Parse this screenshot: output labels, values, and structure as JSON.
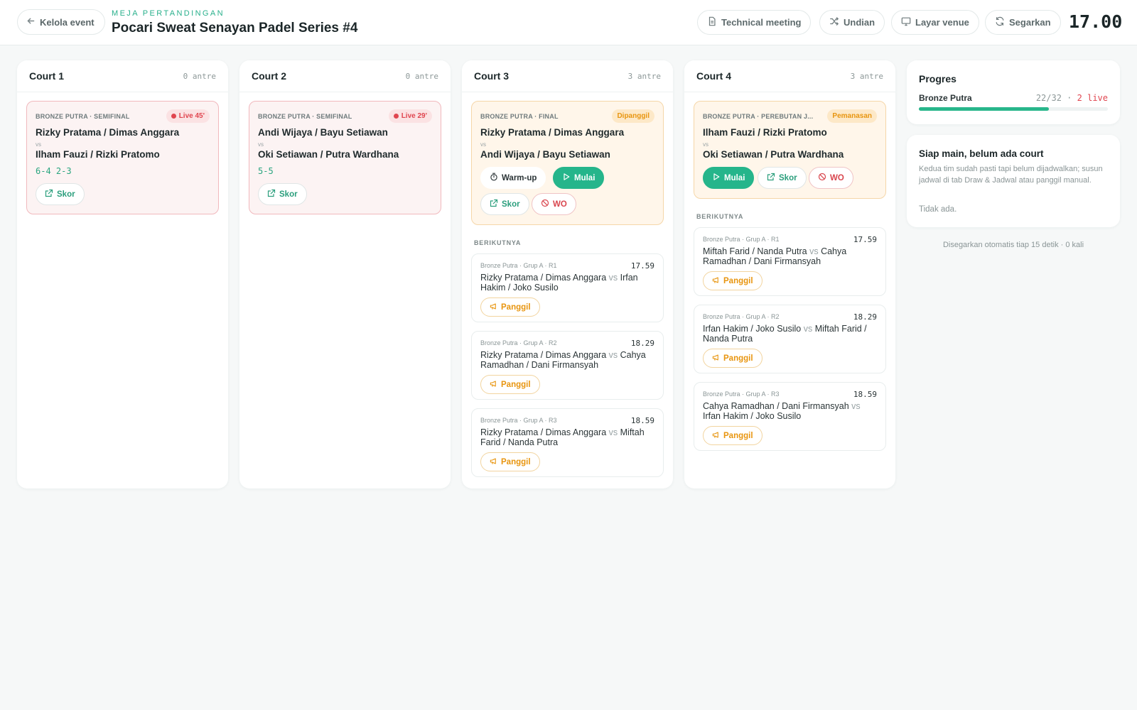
{
  "header": {
    "back_label": "Kelola event",
    "eyebrow": "MEJA PERTANDINGAN",
    "title": "Pocari Sweat Senayan Padel Series #4",
    "buttons": {
      "technical": "Technical meeting",
      "draw": "Undian",
      "venue": "Layar venue",
      "refresh": "Segarkan"
    },
    "clock": "17.00"
  },
  "courts": [
    {
      "name": "Court 1",
      "queue": "0 antre",
      "match": {
        "category": "BRONZE PUTRA · SEMIFINAL",
        "status": "Live 45'",
        "team1": "Rizky Pratama / Dimas Anggara",
        "vs": "vs",
        "team2": "Ilham Fauzi / Rizki Pratomo",
        "score": "6-4 2-3",
        "score_button": "Skor"
      }
    },
    {
      "name": "Court 2",
      "queue": "0 antre",
      "match": {
        "category": "BRONZE PUTRA · SEMIFINAL",
        "status": "Live 29'",
        "team1": "Andi Wijaya / Bayu Setiawan",
        "vs": "vs",
        "team2": "Oki Setiawan / Putra Wardhana",
        "score": "5-5",
        "score_button": "Skor"
      }
    },
    {
      "name": "Court 3",
      "queue": "3 antre",
      "match": {
        "category": "BRONZE PUTRA · FINAL",
        "status": "Dipanggil",
        "team1": "Rizky Pratama / Dimas Anggara",
        "vs": "vs",
        "team2": "Andi Wijaya / Bayu Setiawan",
        "warmup_button": "Warm-up",
        "start_button": "Mulai",
        "score_button": "Skor",
        "wo_button": "WO"
      },
      "next_label": "BERIKUTNYA",
      "next": [
        {
          "category": "Bronze Putra · Grup A · R1",
          "time": "17.59",
          "team1": "Rizky Pratama / Dimas Anggara",
          "vs": "vs",
          "team2": "Irfan Hakim / Joko Susilo",
          "call": "Panggil"
        },
        {
          "category": "Bronze Putra · Grup A · R2",
          "time": "18.29",
          "team1": "Rizky Pratama / Dimas Anggara",
          "vs": "vs",
          "team2": "Cahya Ramadhan / Dani Firmansyah",
          "call": "Panggil"
        },
        {
          "category": "Bronze Putra · Grup A · R3",
          "time": "18.59",
          "team1": "Rizky Pratama / Dimas Anggara",
          "vs": "vs",
          "team2": "Miftah Farid / Nanda Putra",
          "call": "Panggil"
        }
      ]
    },
    {
      "name": "Court 4",
      "queue": "3 antre",
      "match": {
        "category": "BRONZE PUTRA · PEREBUTAN J...",
        "status": "Pemanasan",
        "team1": "Ilham Fauzi / Rizki Pratomo",
        "vs": "vs",
        "team2": "Oki Setiawan / Putra Wardhana",
        "start_button": "Mulai",
        "score_button": "Skor",
        "wo_button": "WO"
      },
      "next_label": "BERIKUTNYA",
      "next": [
        {
          "category": "Bronze Putra · Grup A · R1",
          "time": "17.59",
          "team1": "Miftah Farid / Nanda Putra",
          "vs": "vs",
          "team2": "Cahya Ramadhan / Dani Firmansyah",
          "call": "Panggil"
        },
        {
          "category": "Bronze Putra · Grup A · R2",
          "time": "18.29",
          "team1": "Irfan Hakim / Joko Susilo",
          "vs": "vs",
          "team2": "Miftah Farid / Nanda Putra",
          "call": "Panggil"
        },
        {
          "category": "Bronze Putra · Grup A · R3",
          "time": "18.59",
          "team1": "Cahya Ramadhan / Dani Firmansyah",
          "vs": "vs",
          "team2": "Irfan Hakim / Joko Susilo",
          "call": "Panggil"
        }
      ]
    }
  ],
  "progress": {
    "title": "Progres",
    "category": "Bronze Putra",
    "count": "22/32",
    "separator": "·",
    "live": "2 live",
    "fraction": 0.6875
  },
  "ready": {
    "title": "Siap main, belum ada court",
    "description": "Kedua tim sudah pasti tapi belum dijadwalkan; susun jadwal di tab Draw & Jadwal atau panggil manual.",
    "empty": "Tidak ada."
  },
  "auto_refresh": "Disegarkan otomatis tiap 15 detik · 0 kali",
  "colors": {
    "accent": "#25b58b",
    "live": "#e0454f",
    "called": "#e8950f"
  }
}
